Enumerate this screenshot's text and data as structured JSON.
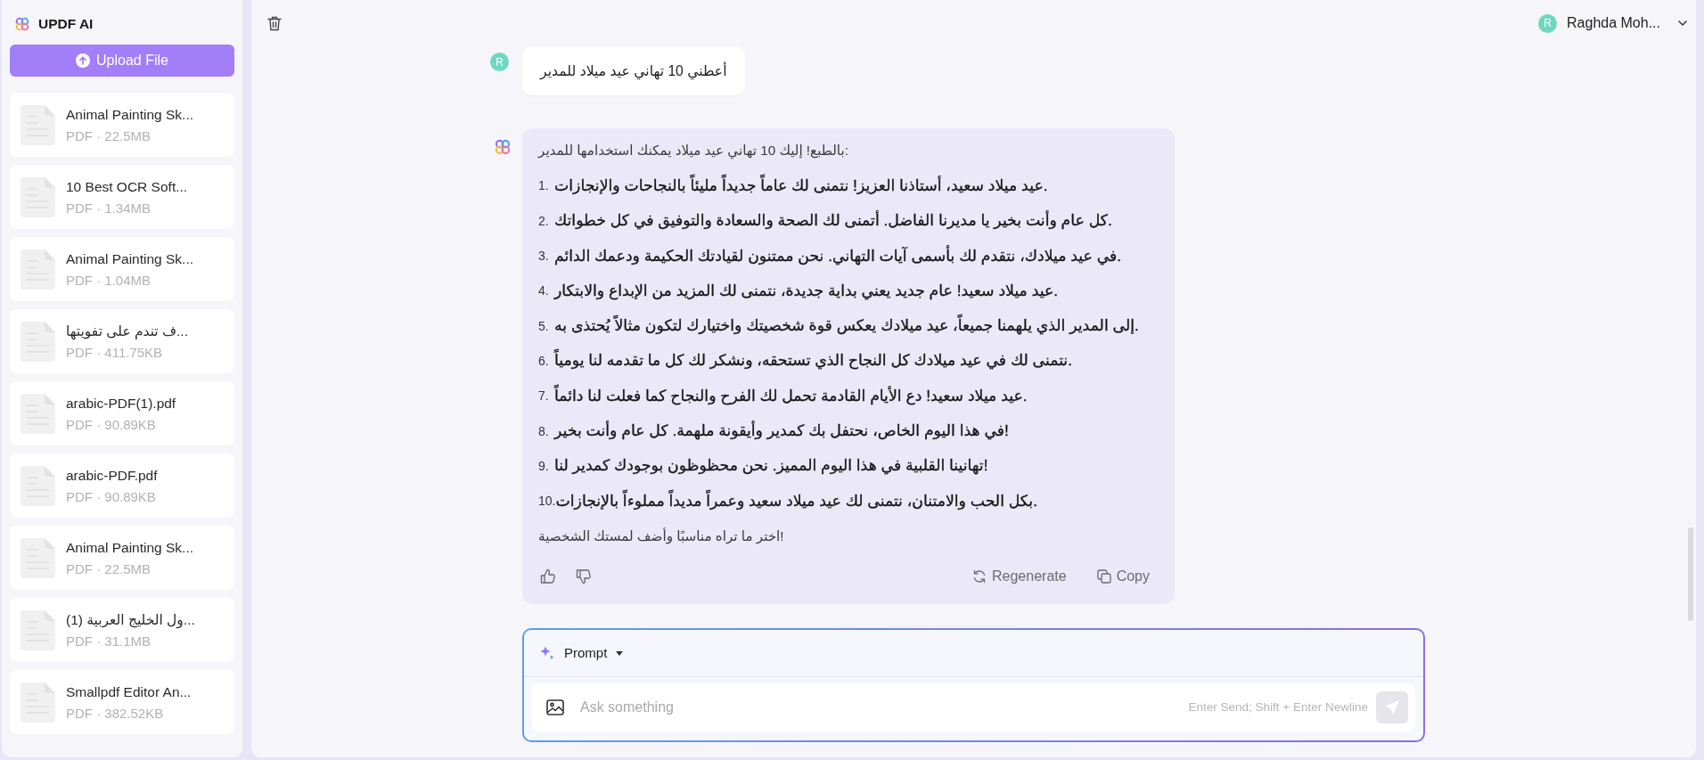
{
  "sidebar": {
    "app_title": "UPDF AI",
    "upload_button": "Upload File",
    "files": [
      {
        "name": "Animal Painting Sk...",
        "meta": "PDF · 22.5MB"
      },
      {
        "name": "10 Best OCR Soft...",
        "meta": "PDF · 1.34MB"
      },
      {
        "name": "Animal Painting Sk...",
        "meta": "PDF · 1.04MB"
      },
      {
        "name": "ف تندم على تفويتها...",
        "meta": "PDF · 411.75KB"
      },
      {
        "name": "arabic-PDF(1).pdf",
        "meta": "PDF · 90.89KB"
      },
      {
        "name": "arabic-PDF.pdf",
        "meta": "PDF · 90.89KB"
      },
      {
        "name": "Animal Painting Sk...",
        "meta": "PDF · 22.5MB"
      },
      {
        "name": "ول الخليج العربية (1)...",
        "meta": "PDF · 31.1MB"
      },
      {
        "name": "Smallpdf Editor An...",
        "meta": "PDF · 382.52KB"
      }
    ]
  },
  "header": {
    "user": {
      "initial": "R",
      "name": "Raghda Moh..."
    }
  },
  "messages": [
    {
      "kind": "user",
      "avatar": "R",
      "text": "أعطني 10 تهاني عيد ميلاد للمدير"
    },
    {
      "kind": "assistant",
      "intro": "بالطبع! إليك 10 تهاني عيد ميلاد يمكنك استخدامها للمدير:",
      "items": [
        {
          "number": "1.",
          "text": "عيد ميلاد سعيد، أستاذنا العزيز! نتمنى لك عاماً جديداً مليئاً بالنجاحات والإنجازات."
        },
        {
          "number": "2.",
          "text": "كل عام وأنت بخير يا مديرنا الفاضل. أتمنى لك الصحة والسعادة والتوفيق في كل خطواتك."
        },
        {
          "number": "3.",
          "text": "في عيد ميلادك، نتقدم لك بأسمى آيات التهاني. نحن ممتنون لقيادتك الحكيمة ودعمك الدائم."
        },
        {
          "number": "4.",
          "text": "عيد ميلاد سعيد! عام جديد يعني بداية جديدة، نتمنى لك المزيد من الإبداع والابتكار."
        },
        {
          "number": "5.",
          "text": "إلى المدير الذي يلهمنا جميعاً، عيد ميلادك يعكس قوة شخصيتك واختيارك لتكون مثالاً يُحتذى به."
        },
        {
          "number": "6.",
          "text": "نتمنى لك في عيد ميلادك كل النجاح الذي تستحقه، ونشكر لك كل ما تقدمه لنا يومياً."
        },
        {
          "number": "7.",
          "text": "عيد ميلاد سعيد! دع الأيام القادمة تحمل لك الفرح والنجاح كما فعلت لنا دائماً."
        },
        {
          "number": "8.",
          "text": "في هذا اليوم الخاص، نحتفل بك كمدير وأيقونة ملهمة. كل عام وأنت بخير!"
        },
        {
          "number": "9.",
          "text": "تهانينا القلبية في هذا اليوم المميز. نحن محظوظون بوجودك كمدير لنا!"
        },
        {
          "number": "10.",
          "text": "بكل الحب والامتنان، نتمنى لك عيد ميلاد سعيد وعمراً مديداً مملوءاً بالإنجازات."
        }
      ],
      "outro": "اختر ما تراه مناسبًا وأضف لمستك الشخصية!",
      "actions": {
        "regenerate": "Regenerate",
        "copy": "Copy"
      }
    }
  ],
  "composer": {
    "mode": "Prompt",
    "placeholder": "Ask something",
    "hint": "Enter Send; Shift + Enter Newline"
  }
}
